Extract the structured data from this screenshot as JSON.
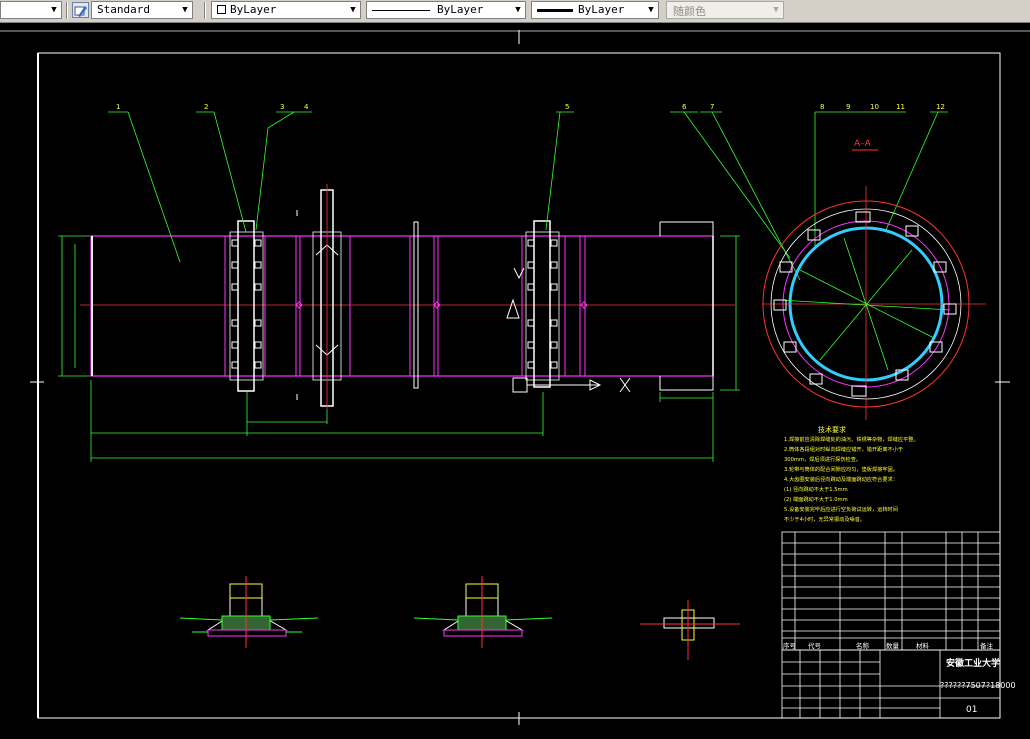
{
  "toolbar": {
    "textstyle": "Standard",
    "layer": "ByLayer",
    "linetype": "ByLayer",
    "lineweight": "ByLayer",
    "color": "随颜色"
  },
  "drawing": {
    "section_label": "A–A",
    "leader_numbers": [
      "1",
      "2",
      "3",
      "4",
      "5",
      "6",
      "7",
      "8",
      "9",
      "10",
      "11",
      "12"
    ],
    "university": "安徽工业大学",
    "drawing_number": "??????7507?18000",
    "sheet": "01",
    "columns": [
      "序号",
      "代号",
      "名称",
      "数量",
      "材料",
      "备注"
    ],
    "notes_title": "技术要求",
    "notes_lines": [
      "1.焊接前应清除焊缝处的油污、铁锈等杂物，焊缝应平整。",
      "2.筒体各段组对时纵向焊缝应错开，错开距离不小于",
      "  300mm，焊后须进行探伤检查。",
      "3.轮带与筒体的配合间隙应均匀，垫板焊接牢固。",
      "4.大齿圈安装后径向跳动及端面跳动应符合要求：",
      "  (1) 径向跳动不大于1.5mm",
      "  (2) 端面跳动不大于1.0mm",
      "5.设备安装完毕后应进行空负荷试运转，运转时间",
      "  不少于4小时，无异常振动及噪音。"
    ]
  }
}
